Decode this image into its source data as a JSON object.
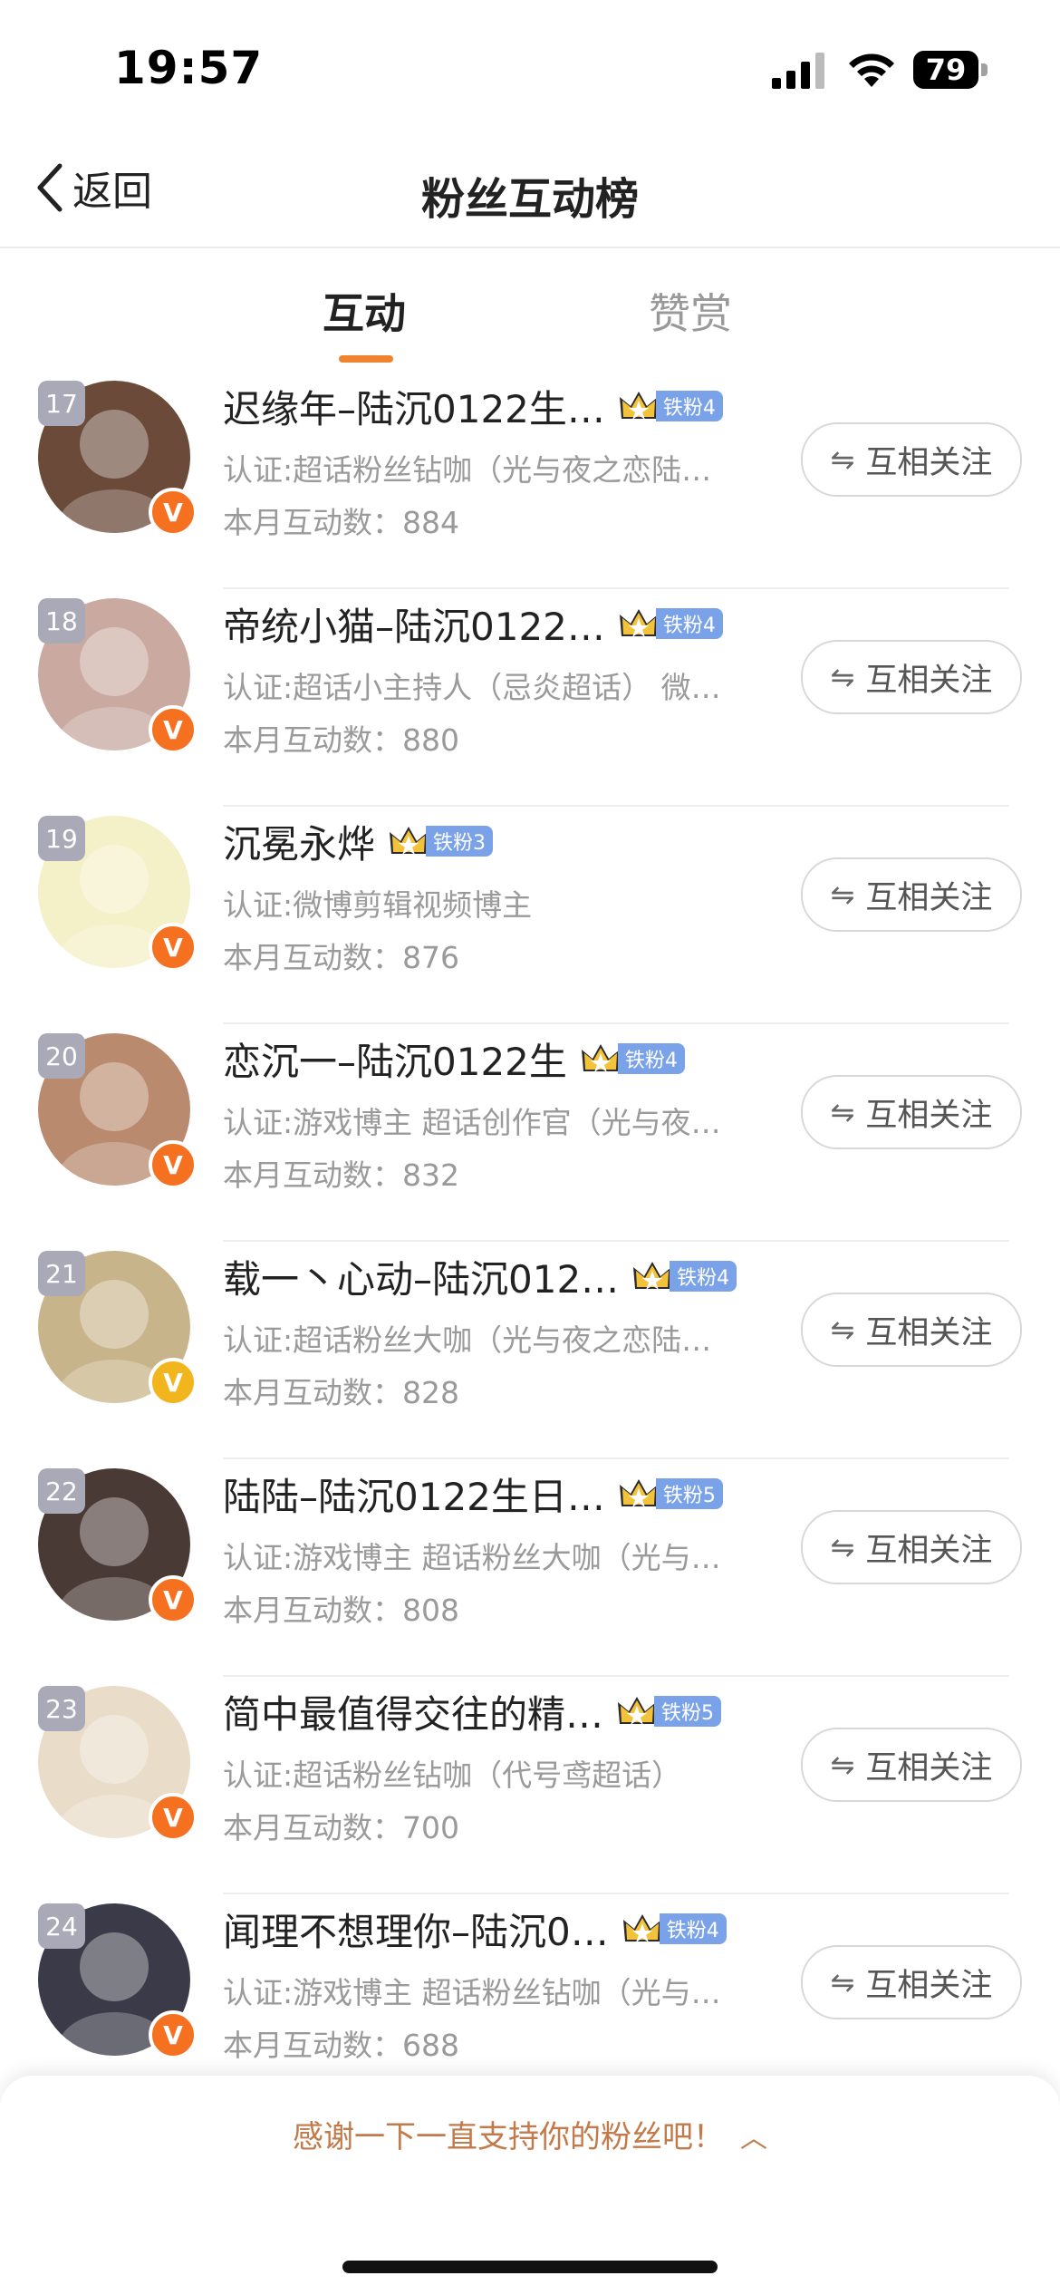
{
  "status_bar": {
    "time": "19:57",
    "battery": "79"
  },
  "nav": {
    "back_label": "返回",
    "title": "粉丝互动榜"
  },
  "tabs": [
    {
      "label": "互动",
      "active": true
    },
    {
      "label": "赞赏",
      "active": false
    }
  ],
  "colors": {
    "accent": "#f0832f",
    "v_orange": "#f5701f",
    "v_gold": "#f2b51e",
    "fan_badge": "#7aa2e8"
  },
  "fans": [
    {
      "rank": "17",
      "name": "迟缘年–陆沉0122生…",
      "badge": "铁粉4",
      "cert": "认证:超话粉丝钻咖（光与夜之恋陆…",
      "count": "本月互动数：884",
      "follow": "互相关注",
      "v": "orange",
      "avatar_color": "#6b4a3a"
    },
    {
      "rank": "18",
      "name": "帝统小猫–陆沉0122…",
      "badge": "铁粉4",
      "cert": "认证:超话小主持人（忌炎超话） 微…",
      "count": "本月互动数：880",
      "follow": "互相关注",
      "v": "orange",
      "avatar_color": "#c9a9a0"
    },
    {
      "rank": "19",
      "name": "沉冕永烨",
      "badge": "铁粉3",
      "cert": "认证:微博剪辑视频博主",
      "count": "本月互动数：876",
      "follow": "互相关注",
      "v": "orange",
      "avatar_color": "#f4f0c8"
    },
    {
      "rank": "20",
      "name": "恋沉一–陆沉0122生",
      "badge": "铁粉4",
      "cert": "认证:游戏博主 超话创作官（光与夜…",
      "count": "本月互动数：832",
      "follow": "互相关注",
      "v": "orange",
      "avatar_color": "#b98a6e"
    },
    {
      "rank": "21",
      "name": "载一丶心动–陆沉012…",
      "badge": "铁粉4",
      "cert": "认证:超话粉丝大咖（光与夜之恋陆…",
      "count": "本月互动数：828",
      "follow": "互相关注",
      "v": "gold",
      "avatar_color": "#c8b48a"
    },
    {
      "rank": "22",
      "name": "陆陆–陆沉0122生日…",
      "badge": "铁粉5",
      "cert": "认证:游戏博主 超话粉丝大咖（光与…",
      "count": "本月互动数：808",
      "follow": "互相关注",
      "v": "orange",
      "avatar_color": "#4a3a35"
    },
    {
      "rank": "23",
      "name": "简中最值得交往的精…",
      "badge": "铁粉5",
      "cert": "认证:超话粉丝钻咖（代号鸢超话）",
      "count": "本月互动数：700",
      "follow": "互相关注",
      "v": "orange",
      "avatar_color": "#e9dcc8"
    },
    {
      "rank": "24",
      "name": "闻理不想理你–陆沉0…",
      "badge": "铁粉4",
      "cert": "认证:游戏博主 超话粉丝钻咖（光与…",
      "count": "本月互动数：688",
      "follow": "互相关注",
      "v": "orange",
      "avatar_color": "#3a3a48"
    }
  ],
  "footer": {
    "text": "感谢一下一直支持你的粉丝吧！"
  }
}
